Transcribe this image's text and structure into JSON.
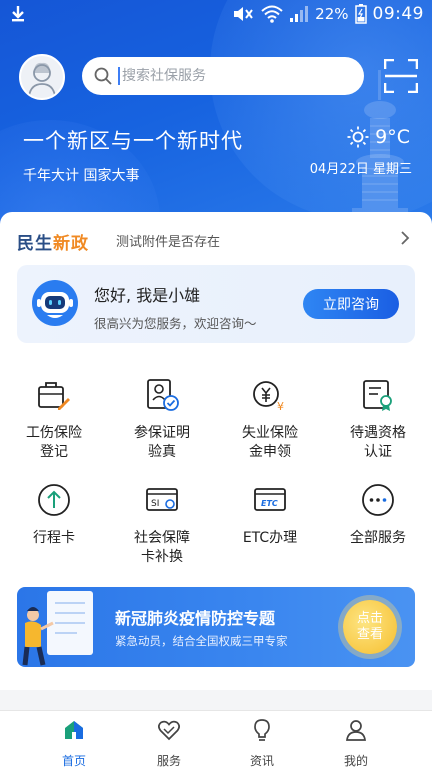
{
  "status_bar": {
    "battery": "22%",
    "time": "09:49"
  },
  "header": {
    "search_placeholder": "搜索社保服务",
    "slogan": "一个新区与一个新时代",
    "sub_slogan": "千年大计 国家大事",
    "weather": {
      "temp": "9°C",
      "icon": "sun-icon"
    },
    "date": "04月22日 星期三"
  },
  "news": {
    "brand_a": "民生",
    "brand_b": "新政",
    "text": "测试附件是否存在"
  },
  "assistant": {
    "greeting": "您好, 我是小雄",
    "sub": "很高兴为您服务，欢迎咨询～",
    "button": "立即咨询"
  },
  "services": [
    {
      "label": "工伤保险\n登记",
      "icon": "briefcase-edit-icon"
    },
    {
      "label": "参保证明\n验真",
      "icon": "id-card-check-icon"
    },
    {
      "label": "失业保险\n金申领",
      "icon": "money-person-icon"
    },
    {
      "label": "待遇资格\n认证",
      "icon": "certificate-icon"
    },
    {
      "label": "行程卡",
      "icon": "arrow-up-circle-icon"
    },
    {
      "label": "社会保障\n卡补换",
      "icon": "si-card-icon"
    },
    {
      "label": "ETC办理",
      "icon": "etc-card-icon"
    },
    {
      "label": "全部服务",
      "icon": "more-dots-icon"
    }
  ],
  "banner": {
    "title": "新冠肺炎疫情防控专题",
    "subtitle": "紧急动员，结合全国权威三甲专家",
    "cta": "点击查看"
  },
  "tabs": [
    {
      "label": "首页",
      "icon": "home-icon",
      "active": true
    },
    {
      "label": "服务",
      "icon": "heart-icon",
      "active": false
    },
    {
      "label": "资讯",
      "icon": "bulb-icon",
      "active": false
    },
    {
      "label": "我的",
      "icon": "user-icon",
      "active": false
    }
  ],
  "colors": {
    "primary": "#1a6ce0",
    "hero": "#1763e0",
    "accent_orange": "#f08a24"
  }
}
